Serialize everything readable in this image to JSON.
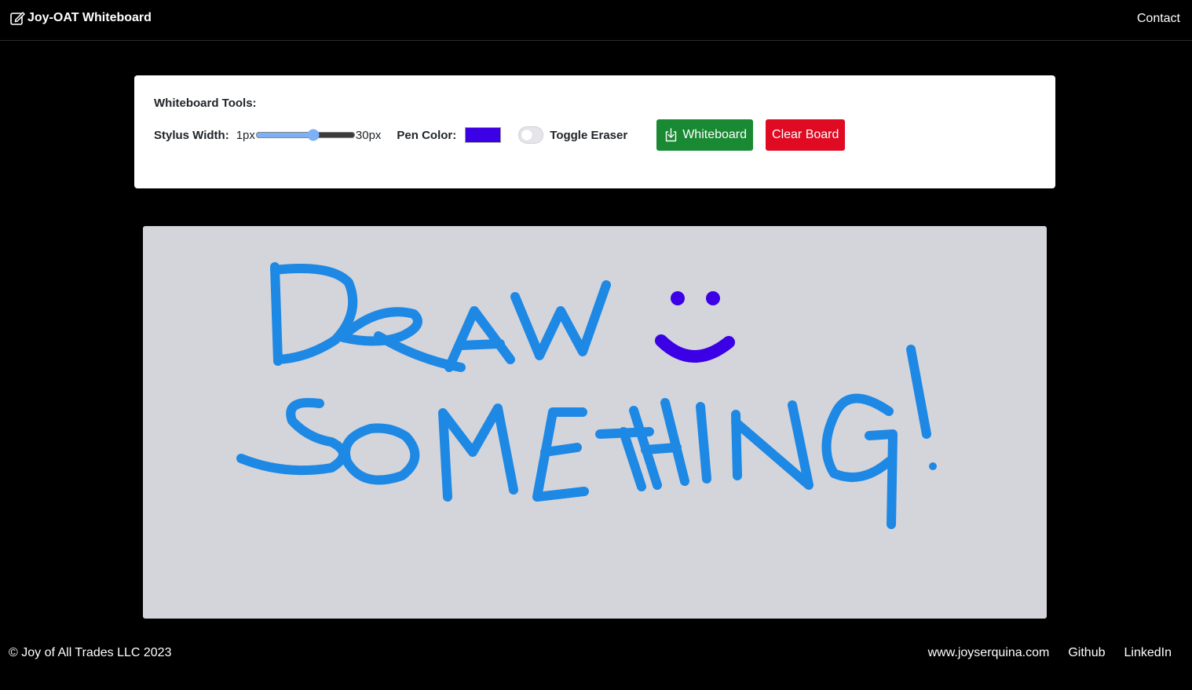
{
  "navbar": {
    "brand": "Joy-OAT Whiteboard",
    "brand_icon": "pencil-square-icon",
    "contact": "Contact"
  },
  "tools": {
    "title": "Whiteboard Tools:",
    "stylus_label": "Stylus Width:",
    "min_label": "1px",
    "max_label": "30px",
    "stylus_min": 1,
    "stylus_max": 30,
    "stylus_value": 18,
    "pen_color_label": "Pen Color:",
    "pen_color": "#3c00e6",
    "eraser_label": "Toggle Eraser",
    "eraser_on": false,
    "save_button": "Whiteboard",
    "save_icon": "download-icon",
    "clear_button": "Clear Board"
  },
  "board": {
    "background": "#d4d5da",
    "drawing_text": "DRAW SOMETHING!",
    "stroke_color_text": "#1e88e5",
    "stroke_color_smiley": "#3c00e6"
  },
  "footer": {
    "copyright": "© Joy of All Trades LLC 2023",
    "links": [
      "www.joyserquina.com",
      "Github",
      "LinkedIn"
    ]
  }
}
